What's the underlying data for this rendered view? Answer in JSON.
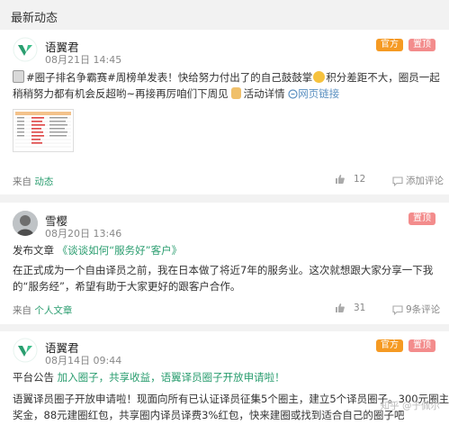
{
  "header": {
    "title": "最新动态"
  },
  "posts": [
    {
      "username": "语翼君",
      "date": "08月21日 14:45",
      "badges": [
        "官方",
        "置顶"
      ],
      "line1_prefix": "#圈子排名争霸赛#周榜单发表！快给努力付出了的自己鼓鼓掌",
      "line1_suffix": "积分差距不大，圈员一起",
      "line2_prefix": "稍稍努力都有机会反超哟~再接再厉咱们下周见",
      "line2_mid": "活动详情",
      "line2_link": "网页链接",
      "source_prefix": "来自",
      "source_link": "动态",
      "likes": "12",
      "comment_label": "添加评论"
    },
    {
      "username": "雪樱",
      "date": "08月20日 13:46",
      "badges": [
        "置顶"
      ],
      "title_prefix": "发布文章",
      "title_link": "《谈谈如何“服务好”客户》",
      "line1": "在正式成为一个自由译员之前，我在日本做了将近7年的服务业。这次就想跟大家分享一下我",
      "line2": "的“服务经”，希望有助于大家更好的跟客户合作。",
      "source_prefix": "来自",
      "source_link": "个人文章",
      "likes": "31",
      "comments": "9条评论"
    },
    {
      "username": "语翼君",
      "date": "08月14日 09:44",
      "badges": [
        "官方",
        "置顶"
      ],
      "title_prefix": "平台公告",
      "title_link": "加入圈子，共享收益，语翼译员圈子开放申请啦！",
      "line1": "语翼译员圈子开放申请啦！现面向所有已认证译员征集5个圈主，建立5个译员圈子。300元圈主",
      "line2": "奖金，88元建圈红包，共享圈内译员译费3%红包，快来建圈或找到适合自己的圈子吧",
      "watermark": "知乎 @于佩尔"
    }
  ],
  "colors": {
    "accent": "#2a9d6f",
    "official_badge": "#f59a23",
    "pinned_badge": "#f38c8c"
  }
}
